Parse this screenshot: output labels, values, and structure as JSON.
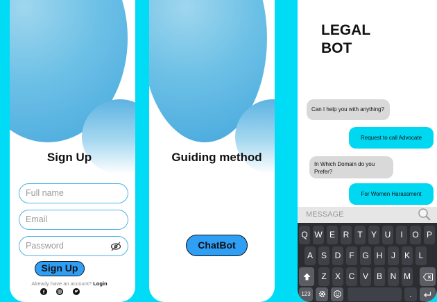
{
  "signup": {
    "title": "Sign Up",
    "fields": [
      {
        "placeholder": "Full name"
      },
      {
        "placeholder": "Email"
      },
      {
        "placeholder": "Password"
      }
    ],
    "submit_label": "Sign Up",
    "account_prompt": "Already have an account?",
    "login_label": "Login",
    "social_icons": [
      "facebook-icon",
      "instagram-icon",
      "twitter-icon"
    ]
  },
  "guide": {
    "title": "Guiding method",
    "chatbot_label": "ChatBot"
  },
  "chat": {
    "title_line1": "LEGAL",
    "title_line2": "BOT",
    "messages": [
      {
        "from": "bot",
        "text": "Can I help you with anything?"
      },
      {
        "from": "user",
        "text": "Request to call Advocate"
      },
      {
        "from": "bot",
        "text": "In Which Domain do you Prefer?"
      },
      {
        "from": "user",
        "text": "For Women Harassment"
      }
    ],
    "input_placeholder": "MESSAGE",
    "keyboard": {
      "row1": [
        "Q",
        "W",
        "E",
        "R",
        "T",
        "Y",
        "U",
        "I",
        "O",
        "P"
      ],
      "row2": [
        "A",
        "S",
        "D",
        "F",
        "G",
        "H",
        "J",
        "K",
        "L"
      ],
      "row3": [
        "Z",
        "X",
        "C",
        "V",
        "B",
        "N",
        "M"
      ],
      "numbers_key": "123",
      "period_key": "."
    }
  },
  "colors": {
    "background": "#00dcf5",
    "accent": "#2f9ef5",
    "user_bubble": "#00d8f2",
    "bot_bubble": "#d9d9d9",
    "keyboard": "#2b2d31"
  }
}
